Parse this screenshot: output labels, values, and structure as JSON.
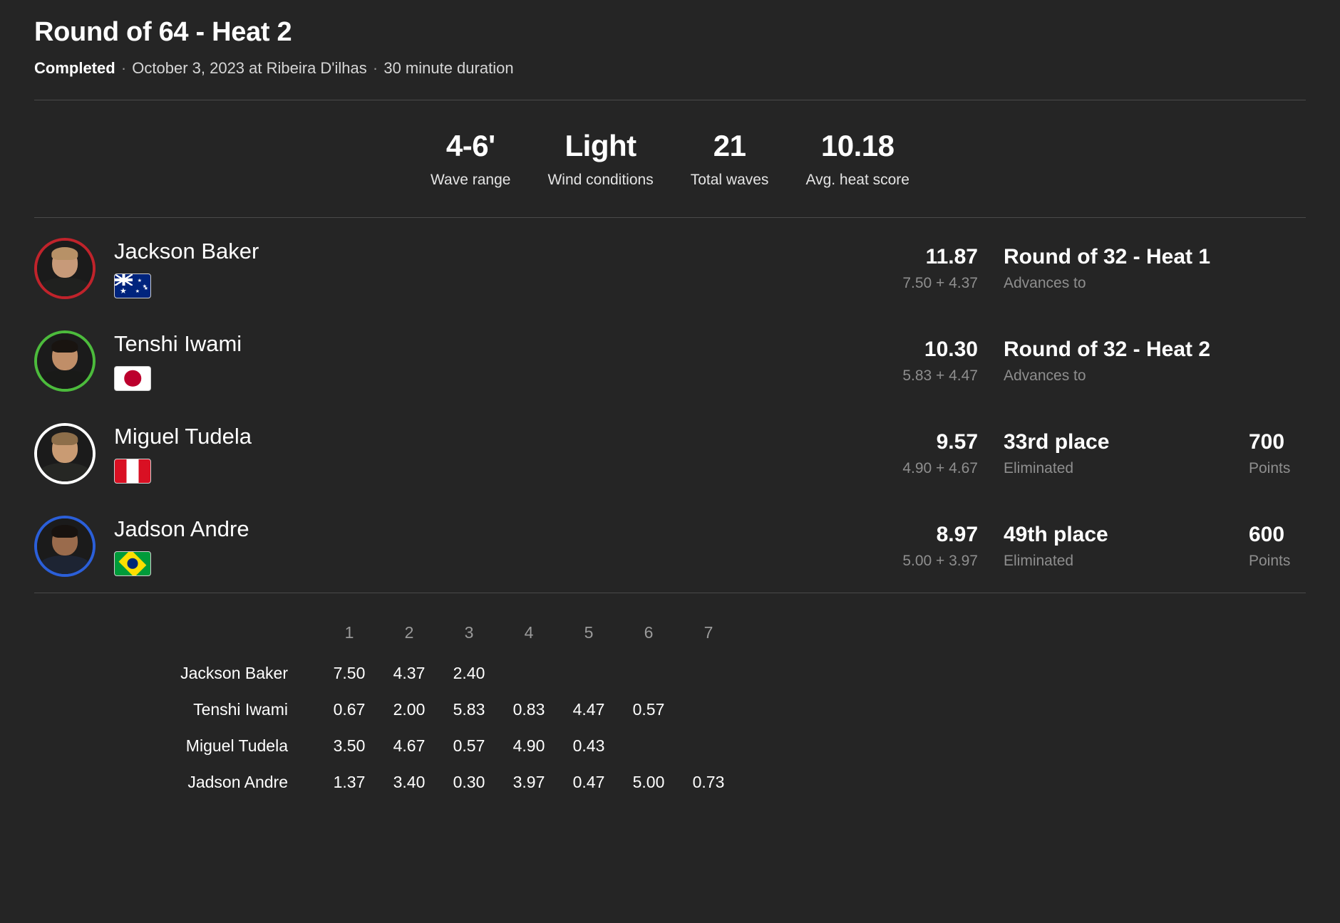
{
  "header": {
    "title": "Round of 64 - Heat 2",
    "status": "Completed",
    "date_location": "October 3, 2023 at Ribeira D'ilhas",
    "duration": "30 minute duration",
    "separator": "·"
  },
  "stats": [
    {
      "value": "4-6'",
      "label": "Wave range"
    },
    {
      "value": "Light",
      "label": "Wind conditions"
    },
    {
      "value": "21",
      "label": "Total waves"
    },
    {
      "value": "10.18",
      "label": "Avg. heat score"
    }
  ],
  "colors": {
    "background": "#252525",
    "ring_red": "#c0232b",
    "ring_green": "#4cbb3c",
    "ring_white": "#ffffff",
    "ring_blue": "#2b5fd9",
    "counted_score": "#e8b62c",
    "muted_text": "#8e8e8e",
    "divider": "#4a4a4a"
  },
  "surfers": [
    {
      "name": "Jackson Baker",
      "country": "Australia",
      "flag": "au",
      "ring_color": "#c0232b",
      "total": "11.87",
      "score_breakdown": "7.50 + 4.37",
      "outcome": "Round of 32 - Heat 1",
      "outcome_sub": "Advances to",
      "points": "",
      "points_label": ""
    },
    {
      "name": "Tenshi Iwami",
      "country": "Japan",
      "flag": "jp",
      "ring_color": "#4cbb3c",
      "total": "10.30",
      "score_breakdown": "5.83 + 4.47",
      "outcome": "Round of 32 - Heat 2",
      "outcome_sub": "Advances to",
      "points": "",
      "points_label": ""
    },
    {
      "name": "Miguel Tudela",
      "country": "Peru",
      "flag": "pe",
      "ring_color": "#ffffff",
      "total": "9.57",
      "score_breakdown": "4.90 + 4.67",
      "outcome": "33rd place",
      "outcome_sub": "Eliminated",
      "points": "700",
      "points_label": "Points"
    },
    {
      "name": "Jadson Andre",
      "country": "Brazil",
      "flag": "br",
      "ring_color": "#2b5fd9",
      "total": "8.97",
      "score_breakdown": "5.00 + 3.97",
      "outcome": "49th place",
      "outcome_sub": "Eliminated",
      "points": "600",
      "points_label": "Points"
    }
  ],
  "wave_table": {
    "columns": [
      "1",
      "2",
      "3",
      "4",
      "5",
      "6",
      "7"
    ],
    "rows": [
      {
        "name": "Jackson Baker",
        "scores": [
          "7.50",
          "4.37",
          "2.40",
          "",
          "",
          "",
          ""
        ],
        "counted": [
          true,
          true,
          false,
          false,
          false,
          false,
          false
        ]
      },
      {
        "name": "Tenshi Iwami",
        "scores": [
          "0.67",
          "2.00",
          "5.83",
          "0.83",
          "4.47",
          "0.57",
          ""
        ],
        "counted": [
          false,
          false,
          true,
          false,
          true,
          false,
          false
        ]
      },
      {
        "name": "Miguel Tudela",
        "scores": [
          "3.50",
          "4.67",
          "0.57",
          "4.90",
          "0.43",
          "",
          ""
        ],
        "counted": [
          false,
          true,
          false,
          true,
          false,
          false,
          false
        ]
      },
      {
        "name": "Jadson Andre",
        "scores": [
          "1.37",
          "3.40",
          "0.30",
          "3.97",
          "0.47",
          "5.00",
          "0.73"
        ],
        "counted": [
          false,
          false,
          false,
          true,
          false,
          true,
          false
        ]
      }
    ]
  }
}
